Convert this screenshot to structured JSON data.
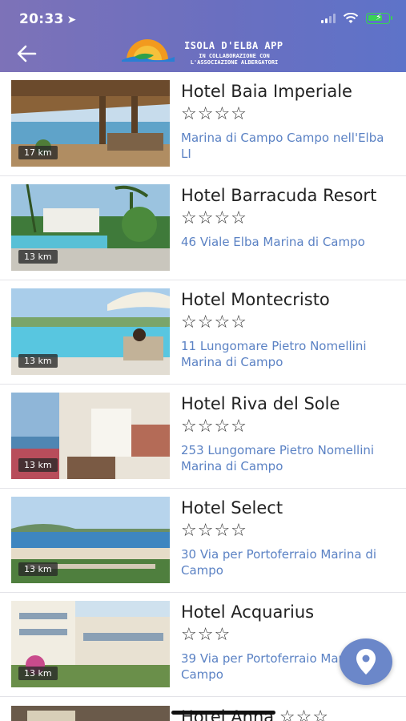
{
  "status": {
    "time": "20:33"
  },
  "header": {
    "app_title": "ISOLA D'ELBA APP",
    "app_subtitle": "IN COLLABORAZIONE CON L'ASSOCIAZIONE ALBERGATORI",
    "logo_text": "Isola d'Elba App"
  },
  "hotels": [
    {
      "name": "Hotel Baia Imperiale",
      "stars": "☆☆☆☆",
      "address": "Marina di Campo Campo nell'Elba LI",
      "distance": "17 km"
    },
    {
      "name": "Hotel Barracuda Resort",
      "stars": "☆☆☆☆",
      "address": "46 Viale Elba Marina di Campo",
      "distance": "13 km"
    },
    {
      "name": "Hotel Montecristo",
      "stars": "☆☆☆☆",
      "address": "11 Lungomare Pietro Nomellini Marina di Campo",
      "distance": "13 km"
    },
    {
      "name": "Hotel Riva del Sole",
      "stars": "☆☆☆☆",
      "address": "253 Lungomare Pietro Nomellini Marina di Campo",
      "distance": "13 km"
    },
    {
      "name": "Hotel Select",
      "stars": "☆☆☆☆",
      "address": "30 Via per Portoferraio Marina di Campo",
      "distance": "13 km"
    },
    {
      "name": "Hotel Acquarius",
      "stars": "☆☆☆",
      "address": "39 Via per Portoferraio Marina di Campo",
      "distance": "13 km"
    },
    {
      "name": "Hotel Anna",
      "stars": "☆☆☆"
    }
  ],
  "colors": {
    "header_start": "#7d72b8",
    "header_end": "#5e73c9",
    "address": "#5b82c4",
    "fab": "#6b87c9",
    "battery": "#39d155"
  },
  "icons": {
    "back": "back-arrow-icon",
    "map": "map-pin-icon",
    "location": "location-arrow-icon"
  }
}
